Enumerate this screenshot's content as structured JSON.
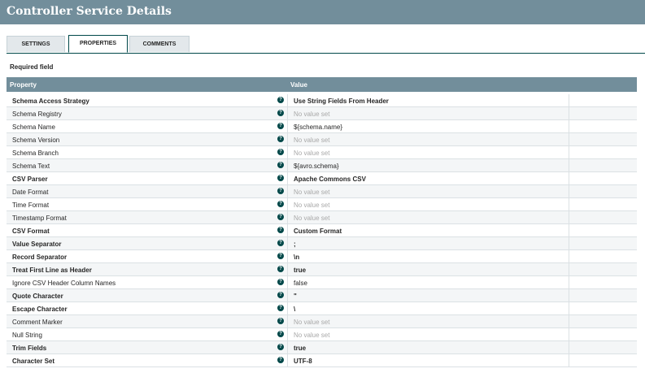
{
  "title": "Controller Service Details",
  "tabs": [
    "SETTINGS",
    "PROPERTIES",
    "COMMENTS"
  ],
  "active_tab": "PROPERTIES",
  "required_label": "Required field",
  "columns": {
    "property": "Property",
    "value": "Value"
  },
  "properties": [
    {
      "name": "Schema Access Strategy",
      "value": "Use String Fields From Header",
      "required": true
    },
    {
      "name": "Schema Registry",
      "value": "No value set",
      "required": false,
      "unset": true
    },
    {
      "name": "Schema Name",
      "value": "${schema.name}",
      "required": false
    },
    {
      "name": "Schema Version",
      "value": "No value set",
      "required": false,
      "unset": true
    },
    {
      "name": "Schema Branch",
      "value": "No value set",
      "required": false,
      "unset": true
    },
    {
      "name": "Schema Text",
      "value": "${avro.schema}",
      "required": false
    },
    {
      "name": "CSV Parser",
      "value": "Apache Commons CSV",
      "required": true
    },
    {
      "name": "Date Format",
      "value": "No value set",
      "required": false,
      "unset": true
    },
    {
      "name": "Time Format",
      "value": "No value set",
      "required": false,
      "unset": true
    },
    {
      "name": "Timestamp Format",
      "value": "No value set",
      "required": false,
      "unset": true
    },
    {
      "name": "CSV Format",
      "value": "Custom Format",
      "required": true
    },
    {
      "name": "Value Separator",
      "value": ";",
      "required": true
    },
    {
      "name": "Record Separator",
      "value": "\\n",
      "required": true
    },
    {
      "name": "Treat First Line as Header",
      "value": "true",
      "required": true
    },
    {
      "name": "Ignore CSV Header Column Names",
      "value": "false",
      "required": false
    },
    {
      "name": "Quote Character",
      "value": "\"",
      "required": true
    },
    {
      "name": "Escape Character",
      "value": "\\",
      "required": true
    },
    {
      "name": "Comment Marker",
      "value": "No value set",
      "required": false,
      "unset": true
    },
    {
      "name": "Null String",
      "value": "No value set",
      "required": false,
      "unset": true
    },
    {
      "name": "Trim Fields",
      "value": "true",
      "required": true
    },
    {
      "name": "Character Set",
      "value": "UTF-8",
      "required": true
    }
  ],
  "help_glyph": "?"
}
